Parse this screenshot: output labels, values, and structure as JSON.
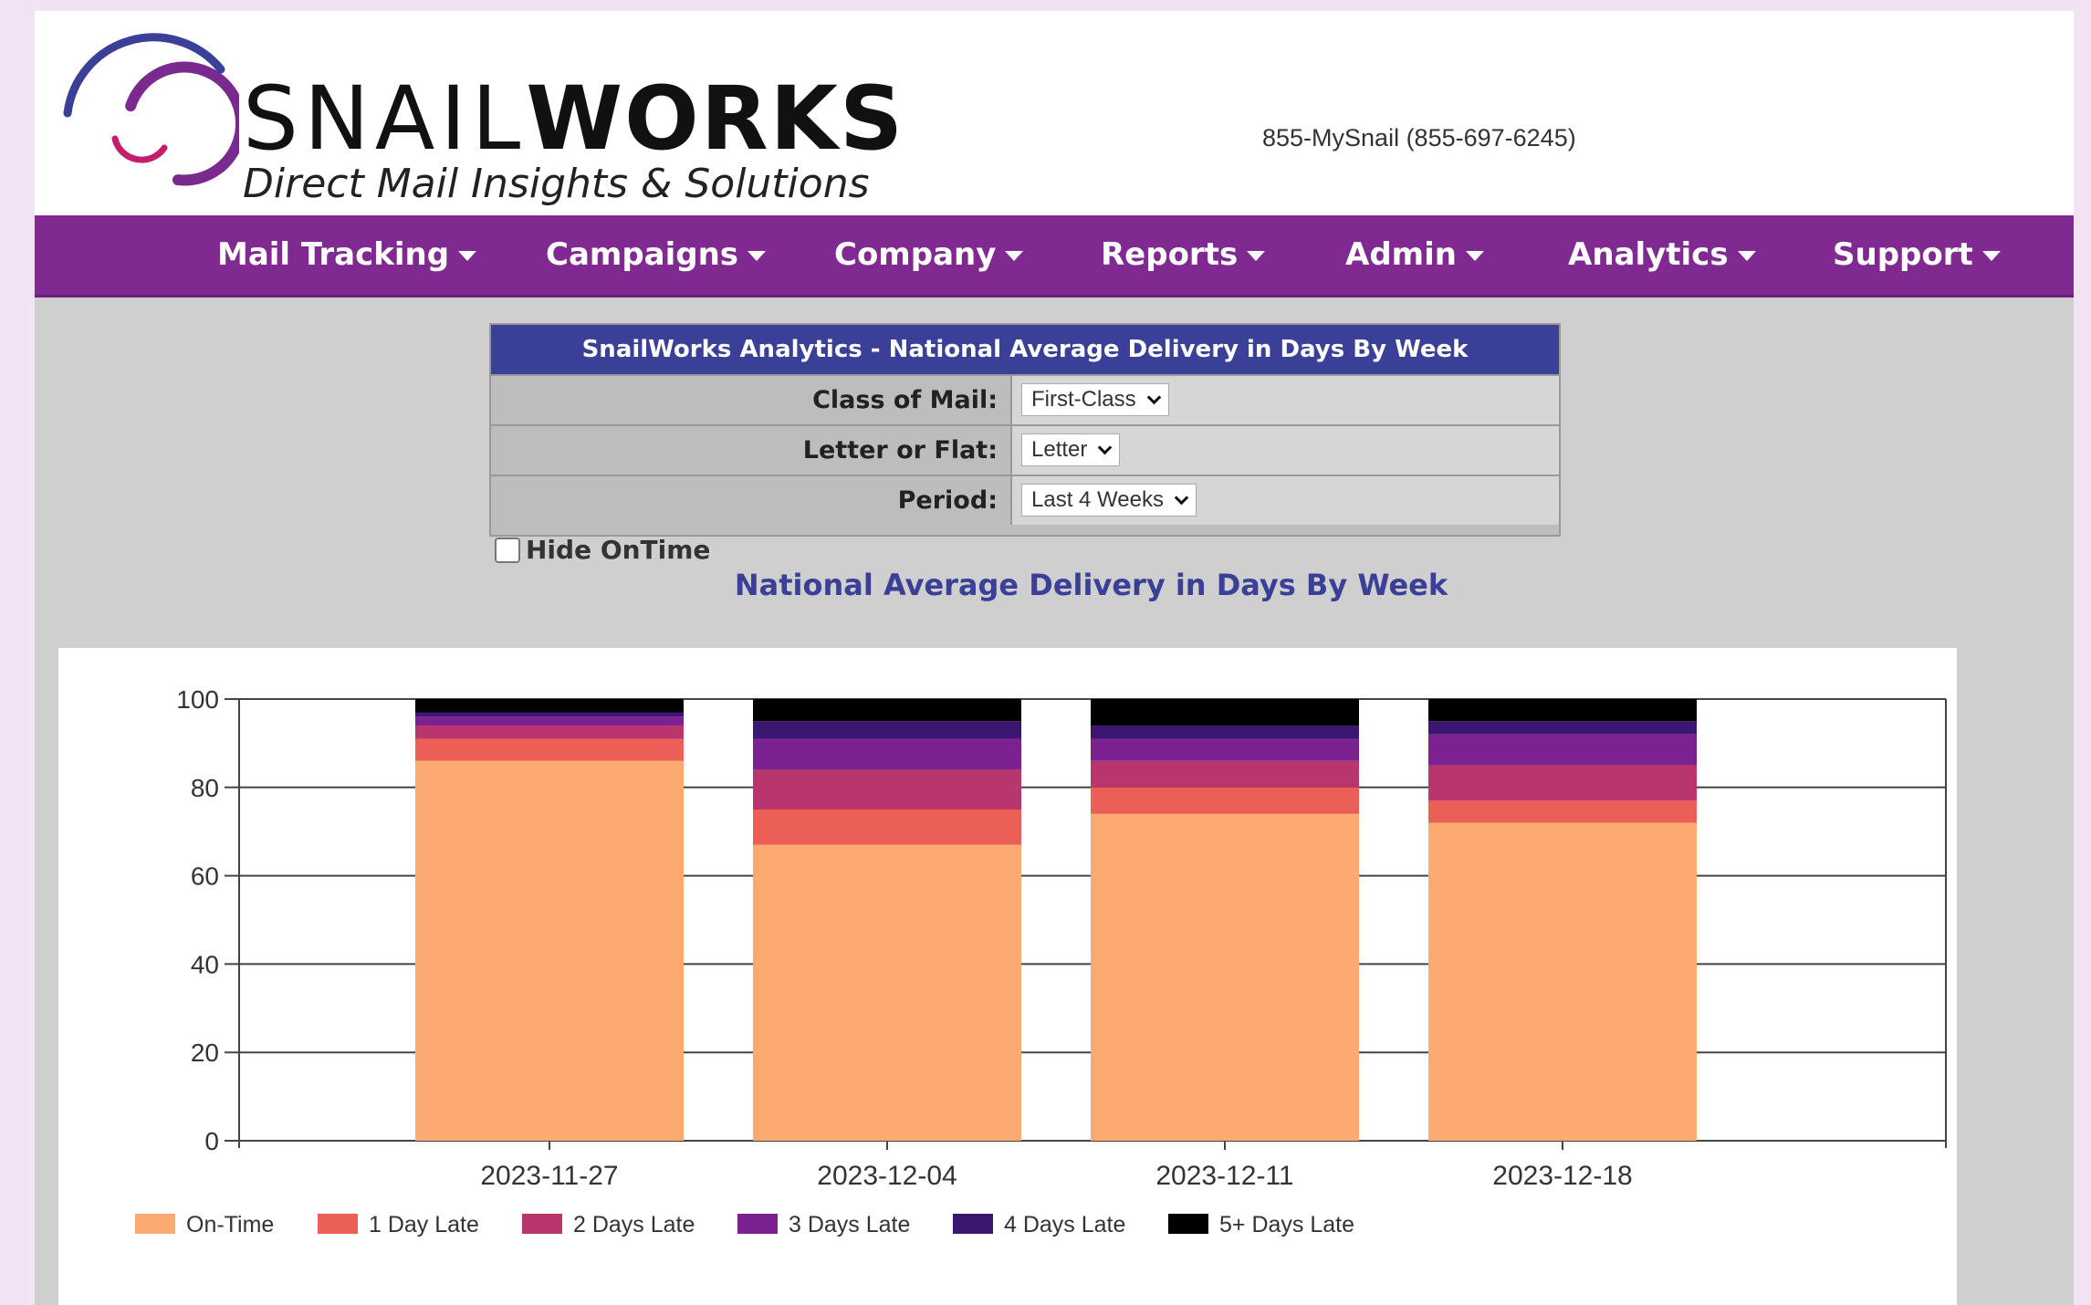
{
  "header": {
    "logo_word_light": "SNAIL",
    "logo_word_bold": "WORKS",
    "logo_tagline": "Direct Mail Insights & Solutions",
    "phone": "855-MySnail (855-697-6245)"
  },
  "nav": {
    "items": [
      {
        "label": "Mail Tracking"
      },
      {
        "label": "Campaigns"
      },
      {
        "label": "Company"
      },
      {
        "label": "Reports"
      },
      {
        "label": "Admin"
      },
      {
        "label": "Analytics"
      },
      {
        "label": "Support"
      }
    ]
  },
  "filters": {
    "title": "SnailWorks Analytics - National Average Delivery in Days By Week",
    "class_label": "Class of Mail:",
    "class_value": "First-Class",
    "shape_label": "Letter or Flat:",
    "shape_value": "Letter",
    "period_label": "Period:",
    "period_value": "Last 4 Weeks",
    "hide_ontime_label": "Hide OnTime",
    "hide_ontime_checked": false
  },
  "chart_heading": "National Average Delivery in Days By Week",
  "chart_data": {
    "type": "bar",
    "stacked": true,
    "categories": [
      "2023-11-27",
      "2023-12-04",
      "2023-12-11",
      "2023-12-18"
    ],
    "ylim": [
      0,
      100
    ],
    "yticks": [
      0,
      20,
      40,
      60,
      80,
      100
    ],
    "grid": true,
    "legend_position": "bottom-left",
    "series": [
      {
        "name": "On-Time",
        "color": "#fca972",
        "values": [
          86,
          67,
          74,
          72
        ]
      },
      {
        "name": "1 Day Late",
        "color": "#ec5f57",
        "values": [
          5,
          8,
          6,
          5
        ]
      },
      {
        "name": "2 Days Late",
        "color": "#b9356d",
        "values": [
          3,
          9,
          6,
          8
        ]
      },
      {
        "name": "3 Days Late",
        "color": "#7b2290",
        "values": [
          2,
          7,
          5,
          7
        ]
      },
      {
        "name": "4 Days Late",
        "color": "#3c1771",
        "values": [
          1,
          4,
          3,
          3
        ]
      },
      {
        "name": "5+ Days Late",
        "color": "#000000",
        "values": [
          3,
          5,
          6,
          5
        ]
      }
    ]
  }
}
